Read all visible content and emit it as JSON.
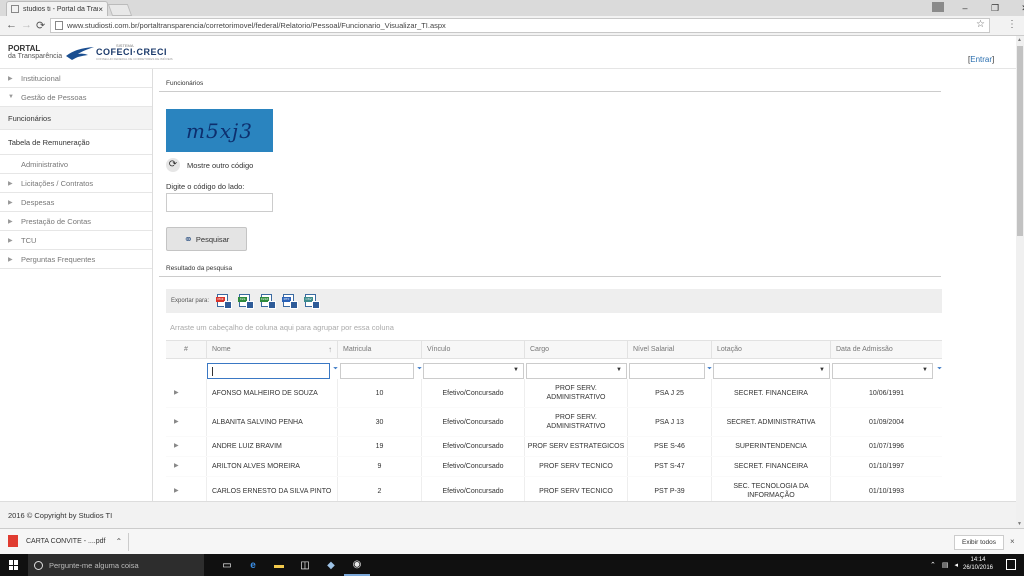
{
  "browser": {
    "tab_title": "studios ti - Portal da Tran",
    "tab_close": "×",
    "url": "www.studiosti.com.br/portaltransparencia/corretorimovel/federal/Relatorio/Pessoal/Funcionario_Visualizar_TI.aspx",
    "win_minimize": "–",
    "win_restore": "❐",
    "win_close": "✕",
    "back": "←",
    "forward": "→",
    "reload": "⟳",
    "star": "☆",
    "menu": "⋮"
  },
  "header": {
    "portal_l1": "PORTAL",
    "portal_l2": "da Transparência",
    "cofeci_sistema": "SISTEMA",
    "cofeci_name": "COFECI·CRECI",
    "cofeci_sub": "CONSELHO FEDERAL DE CORRETORES DE IMÓVEIS",
    "entrar_open": "[",
    "entrar": "Entrar",
    "entrar_close": "]"
  },
  "sidebar": {
    "items": [
      {
        "label": "Institucional",
        "arrow": "▶"
      },
      {
        "label": "Gestão de Pessoas",
        "arrow": "▼"
      },
      {
        "label": "Funcionários"
      },
      {
        "label": "Tabela de Remuneração"
      },
      {
        "label": "Administrativo"
      },
      {
        "label": "Licitações / Contratos",
        "arrow": "▶"
      },
      {
        "label": "Despesas",
        "arrow": "▶"
      },
      {
        "label": "Prestação de Contas",
        "arrow": "▶"
      },
      {
        "label": "TCU",
        "arrow": "▶"
      },
      {
        "label": "Perguntas Frequentes",
        "arrow": "▶"
      }
    ]
  },
  "main": {
    "section_title": "Funcionários",
    "captcha_text": "m5xj3",
    "refresh_label": "Mostre outro código",
    "code_label": "Digite o código do lado:",
    "code_value": "",
    "search_button": "Pesquisar",
    "results_title": "Resultado da pesquisa",
    "export_label": "Exportar para:",
    "export_formats": [
      "PDF",
      "XLS",
      "XLSX",
      "RTF",
      "CSV"
    ],
    "group_hint": "Arraste um cabeçalho de coluna aqui para agrupar por essa coluna"
  },
  "grid": {
    "columns": [
      "#",
      "Nome",
      "Matricula",
      "Vínculo",
      "Cargo",
      "Nível Salarial",
      "Lotação",
      "Data de Admissão"
    ],
    "sort_glyph": "↑",
    "rows": [
      {
        "nome": "AFONSO MALHEIRO DE SOUZA",
        "matricula": "10",
        "vinculo": "Efetivo/Concursado",
        "cargo": "PROF SERV. ADMINISTRATIVO",
        "nivel": "PSA J 25",
        "lotacao": "SECRET. FINANCEIRA",
        "admissao": "10/06/1991"
      },
      {
        "nome": "ALBANITA SALVINO PENHA",
        "matricula": "30",
        "vinculo": "Efetivo/Concursado",
        "cargo": "PROF SERV. ADMINISTRATIVO",
        "nivel": "PSA J 13",
        "lotacao": "SECRET. ADMINISTRATIVA",
        "admissao": "01/09/2004"
      },
      {
        "nome": "ANDRE LUIZ BRAVIM",
        "matricula": "19",
        "vinculo": "Efetivo/Concursado",
        "cargo": "PROF SERV ESTRATEGICOS",
        "nivel": "PSE S-46",
        "lotacao": "SUPERINTENDENCIA",
        "admissao": "01/07/1996"
      },
      {
        "nome": "ARILTON ALVES MOREIRA",
        "matricula": "9",
        "vinculo": "Efetivo/Concursado",
        "cargo": "PROF SERV TECNICO",
        "nivel": "PST S-47",
        "lotacao": "SECRET. FINANCEIRA",
        "admissao": "01/10/1997"
      },
      {
        "nome": "CARLOS ERNESTO DA SILVA PINTO",
        "matricula": "2",
        "vinculo": "Efetivo/Concursado",
        "cargo": "PROF SERV TECNICO",
        "nivel": "PST P-39",
        "lotacao": "SEC. TECNOLOGIA DA INFORMAÇÃO",
        "admissao": "01/10/1993"
      }
    ]
  },
  "footer": {
    "copyright": "2016 © Copyright by Studios TI"
  },
  "downloads": {
    "file": "CARTA CONVITE - ....pdf",
    "show_all": "Exibir todos",
    "close": "×"
  },
  "taskbar": {
    "search_placeholder": "Pergunte-me alguma coisa",
    "time": "14:14",
    "date": "26/10/2016"
  }
}
